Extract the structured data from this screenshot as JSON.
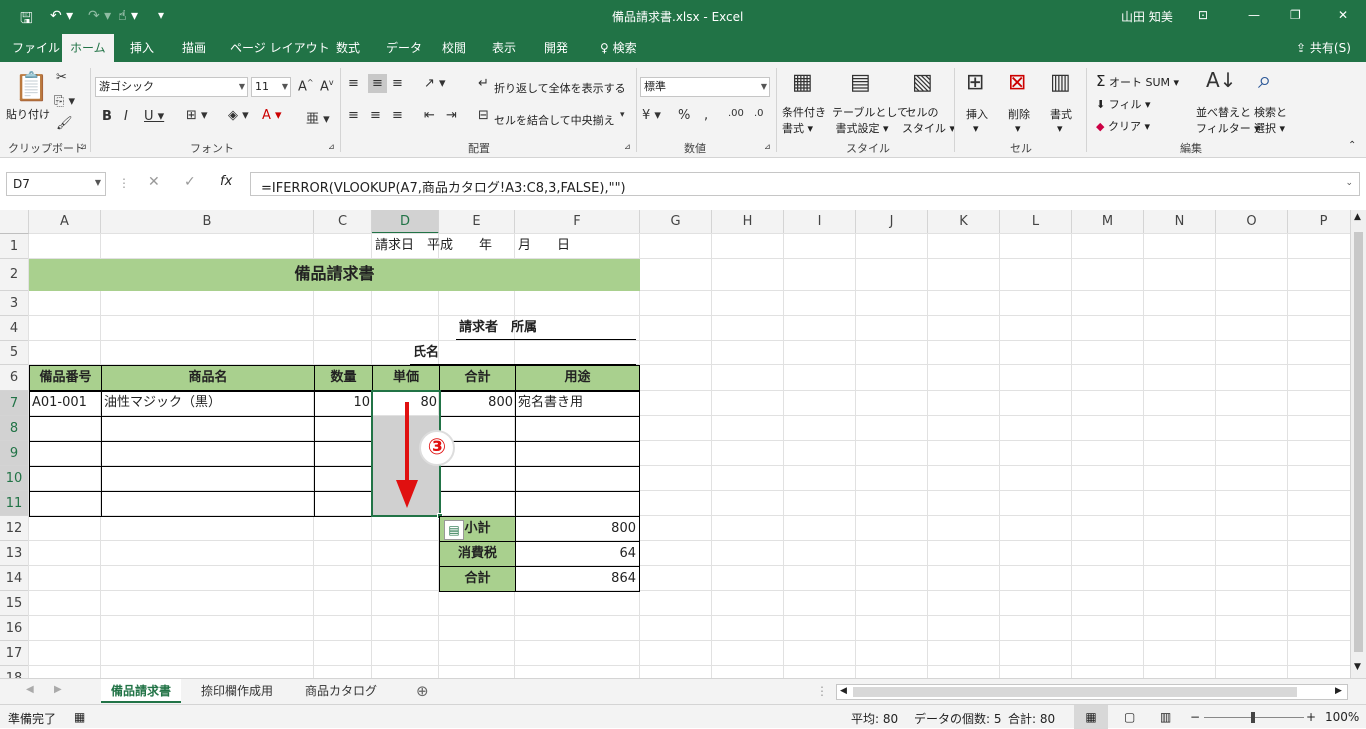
{
  "title": {
    "file": "備品請求書.xlsx - Excel",
    "user": "山田 知美"
  },
  "tabs": [
    "ファイル",
    "ホーム",
    "挿入",
    "描画",
    "ページ レイアウト",
    "数式",
    "データ",
    "校閲",
    "表示",
    "開発"
  ],
  "search_label": "検索",
  "share_label": "共有(S)",
  "ribbon": {
    "paste": "貼り付け",
    "clipboard": "クリップボード",
    "font_name": "游ゴシック",
    "font_size": "11",
    "font_group": "フォント",
    "wrap": "折り返して全体を表示する",
    "merge": "セルを結合して中央揃え",
    "align_group": "配置",
    "number_format": "標準",
    "number_group": "数値",
    "cond1": "条件付き",
    "cond2": "書式",
    "table1": "テーブルとして",
    "table2": "書式設定",
    "cellstyle1": "セルの",
    "cellstyle2": "スタイル",
    "style_group": "スタイル",
    "insert": "挿入",
    "delete": "削除",
    "format": "書式",
    "cells_group": "セル",
    "autosum": "オート SUM",
    "fill": "フィル",
    "clear": "クリア",
    "sort1": "並べ替えと",
    "sort2": "フィルター",
    "find1": "検索と",
    "find2": "選択",
    "edit_group": "編集"
  },
  "namebox": "D7",
  "formula": "=IFERROR(VLOOKUP(A7,商品カタログ!A3:C8,3,FALSE),\"\")",
  "columns": [
    "A",
    "B",
    "C",
    "D",
    "E",
    "F",
    "G",
    "H",
    "I",
    "J",
    "K",
    "L",
    "M",
    "N",
    "O",
    "P"
  ],
  "rows": [
    "1",
    "2",
    "3",
    "4",
    "5",
    "6",
    "7",
    "8",
    "9",
    "10",
    "11",
    "12",
    "13",
    "14",
    "15",
    "16",
    "17",
    "18"
  ],
  "sheet": {
    "date": "請求日　平成　　年　　月　　日",
    "title": "備品請求書",
    "requester": "請求者　所属",
    "name": "氏名",
    "headers": [
      "備品番号",
      "商品名",
      "数量",
      "単価",
      "合計",
      "用途"
    ],
    "row7": [
      "A01-001",
      "油性マジック（黒）",
      "10",
      "80",
      "800",
      "宛名書き用"
    ],
    "subtotal_label": "小計",
    "subtotal": "800",
    "tax_label": "消費税",
    "tax": "64",
    "total_label": "合計",
    "total": "864",
    "callout": "③"
  },
  "sheet_tabs": [
    "備品請求書",
    "捺印欄作成用",
    "商品カタログ"
  ],
  "status": {
    "ready": "準備完了",
    "avg": "平均: 80",
    "count": "データの個数: 5",
    "sum": "合計: 80",
    "zoom": "100%"
  }
}
